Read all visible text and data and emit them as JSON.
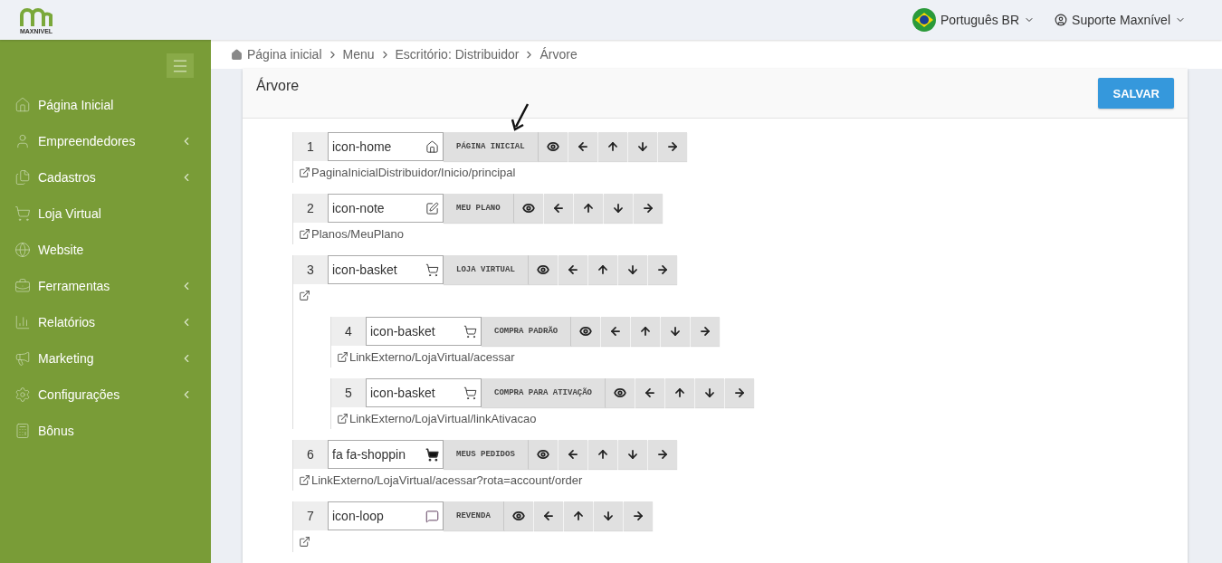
{
  "header": {
    "logo_text": "MAXNIVEL",
    "language": "Português BR",
    "user": "Suporte Maxnível"
  },
  "sidebar": {
    "items": [
      {
        "label": "Página Inicial",
        "has_submenu": false
      },
      {
        "label": "Empreendedores",
        "has_submenu": true
      },
      {
        "label": "Cadastros",
        "has_submenu": true
      },
      {
        "label": "Loja Virtual",
        "has_submenu": false
      },
      {
        "label": "Website",
        "has_submenu": false
      },
      {
        "label": "Ferramentas",
        "has_submenu": true
      },
      {
        "label": "Relatórios",
        "has_submenu": true
      },
      {
        "label": "Marketing",
        "has_submenu": true
      },
      {
        "label": "Configurações",
        "has_submenu": true
      },
      {
        "label": "Bônus",
        "has_submenu": false
      }
    ]
  },
  "breadcrumb": [
    "Página inicial",
    "Menu",
    "Escritório: Distribuidor",
    "Árvore"
  ],
  "card": {
    "title": "Árvore",
    "save_button": "SALVAR"
  },
  "tree": [
    {
      "number": "1",
      "kind": "home",
      "icon_value": "icon-home",
      "label": "PÁGINA INICIAL",
      "link": "PaginaInicialDistribuidor/Inicio/principal"
    },
    {
      "number": "2",
      "kind": "note",
      "icon_value": "icon-note",
      "label": "MEU PLANO",
      "link": "Planos/MeuPlano"
    },
    {
      "number": "3",
      "kind": "basket",
      "icon_value": "icon-basket",
      "label": "LOJA VIRTUAL",
      "children": [
        {
          "number": "4",
          "kind": "basket",
          "icon_value": "icon-basket",
          "label": "COMPRA PADRÃO",
          "link": "LinkExterno/LojaVirtual/acessar"
        },
        {
          "number": "5",
          "kind": "basket",
          "icon_value": "icon-basket",
          "label": "COMPRA PARA ATIVAÇÃO",
          "link": "LinkExterno/LojaVirtual/linkAtivacao"
        }
      ]
    },
    {
      "number": "6",
      "kind": "cart",
      "icon_value": "fa fa-shoppin",
      "label": "MEUS PEDIDOS",
      "link": "LinkExterno/LojaVirtual/acessar?rota=account/order"
    },
    {
      "number": "7",
      "kind": "loop",
      "icon_value": "icon-loop",
      "label": "REVENDA"
    }
  ]
}
